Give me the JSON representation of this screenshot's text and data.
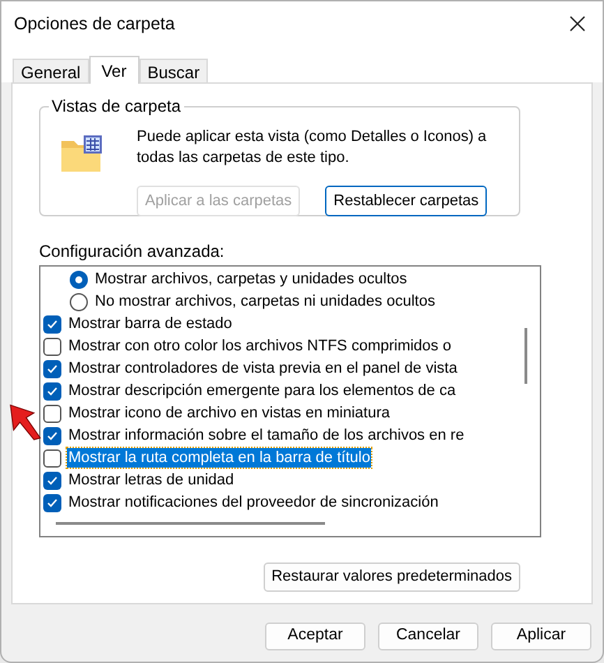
{
  "window": {
    "title": "Opciones de carpeta"
  },
  "tabs": [
    {
      "label": "General",
      "selected": false
    },
    {
      "label": "Ver",
      "selected": true
    },
    {
      "label": "Buscar",
      "selected": false
    }
  ],
  "folder_views": {
    "title": "Vistas de carpeta",
    "description": "Puede aplicar esta vista (como Detalles o Iconos) a todas las carpetas de este tipo.",
    "buttons": [
      {
        "label": "Aplicar a las carpetas",
        "disabled": true
      },
      {
        "label": "Restablecer carpetas",
        "disabled": false
      }
    ]
  },
  "advanced": {
    "label": "Configuración avanzada:",
    "items": [
      {
        "kind": "radio",
        "label": "Mostrar archivos, carpetas y unidades ocultos",
        "checked": true,
        "selected": false
      },
      {
        "kind": "radio",
        "label": "No mostrar archivos, carpetas ni unidades ocultos",
        "checked": false,
        "selected": false
      },
      {
        "kind": "checkbox",
        "label": "Mostrar barra de estado",
        "checked": true,
        "selected": false
      },
      {
        "kind": "checkbox",
        "label": "Mostrar con otro color los archivos NTFS comprimidos o",
        "checked": false,
        "selected": false
      },
      {
        "kind": "checkbox",
        "label": "Mostrar controladores de vista previa en el panel de vista",
        "checked": true,
        "selected": false
      },
      {
        "kind": "checkbox",
        "label": "Mostrar descripción emergente para los elementos de ca",
        "checked": true,
        "selected": false
      },
      {
        "kind": "checkbox",
        "label": "Mostrar icono de archivo en vistas en miniatura",
        "checked": false,
        "selected": false
      },
      {
        "kind": "checkbox",
        "label": "Mostrar información sobre el tamaño de los archivos en re",
        "checked": true,
        "selected": false
      },
      {
        "kind": "checkbox",
        "label": "Mostrar la ruta completa en la barra de título",
        "checked": false,
        "selected": true
      },
      {
        "kind": "checkbox",
        "label": "Mostrar letras de unidad",
        "checked": true,
        "selected": false
      },
      {
        "kind": "checkbox",
        "label": "Mostrar notificaciones del proveedor de sincronización",
        "checked": true,
        "selected": false
      }
    ],
    "restore_button": "Restaurar valores predeterminados"
  },
  "buttons": [
    "Aceptar",
    "Cancelar",
    "Aplicar"
  ]
}
